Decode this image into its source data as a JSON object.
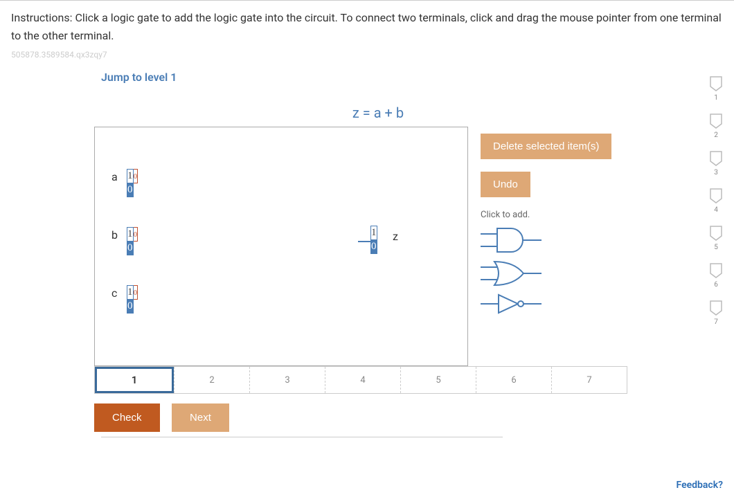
{
  "instructions": "Instructions: Click a logic gate to add the logic gate into the circuit. To connect two terminals, click and drag the mouse pointer from one terminal to the other terminal.",
  "qid": "505878.3589584.qx3zqy7",
  "jump_link": "Jump to level 1",
  "equation": "z = a + b",
  "inputs": {
    "a": {
      "label": "a",
      "top": "1",
      "small": "0",
      "bottom": "0"
    },
    "b": {
      "label": "b",
      "top": "1",
      "small": "0",
      "bottom": "0"
    },
    "c": {
      "label": "c",
      "top": "1",
      "small": "0",
      "bottom": "0"
    }
  },
  "output": {
    "label": "z",
    "top": "1",
    "bottom": "0"
  },
  "right_panel": {
    "delete_label": "Delete selected item(s)",
    "undo_label": "Undo",
    "click_to_add": "Click to add."
  },
  "gates": [
    {
      "name": "and-gate-icon"
    },
    {
      "name": "or-gate-icon"
    },
    {
      "name": "not-gate-icon"
    }
  ],
  "steps": [
    "1",
    "2",
    "3",
    "4",
    "5",
    "6",
    "7"
  ],
  "active_step": 0,
  "bottom": {
    "check": "Check",
    "next": "Next"
  },
  "shields": [
    "1",
    "2",
    "3",
    "4",
    "5",
    "6",
    "7"
  ],
  "feedback": "Feedback?",
  "colors": {
    "accent": "#4a7db5",
    "tan": "#dea876",
    "orange": "#c05a20"
  }
}
